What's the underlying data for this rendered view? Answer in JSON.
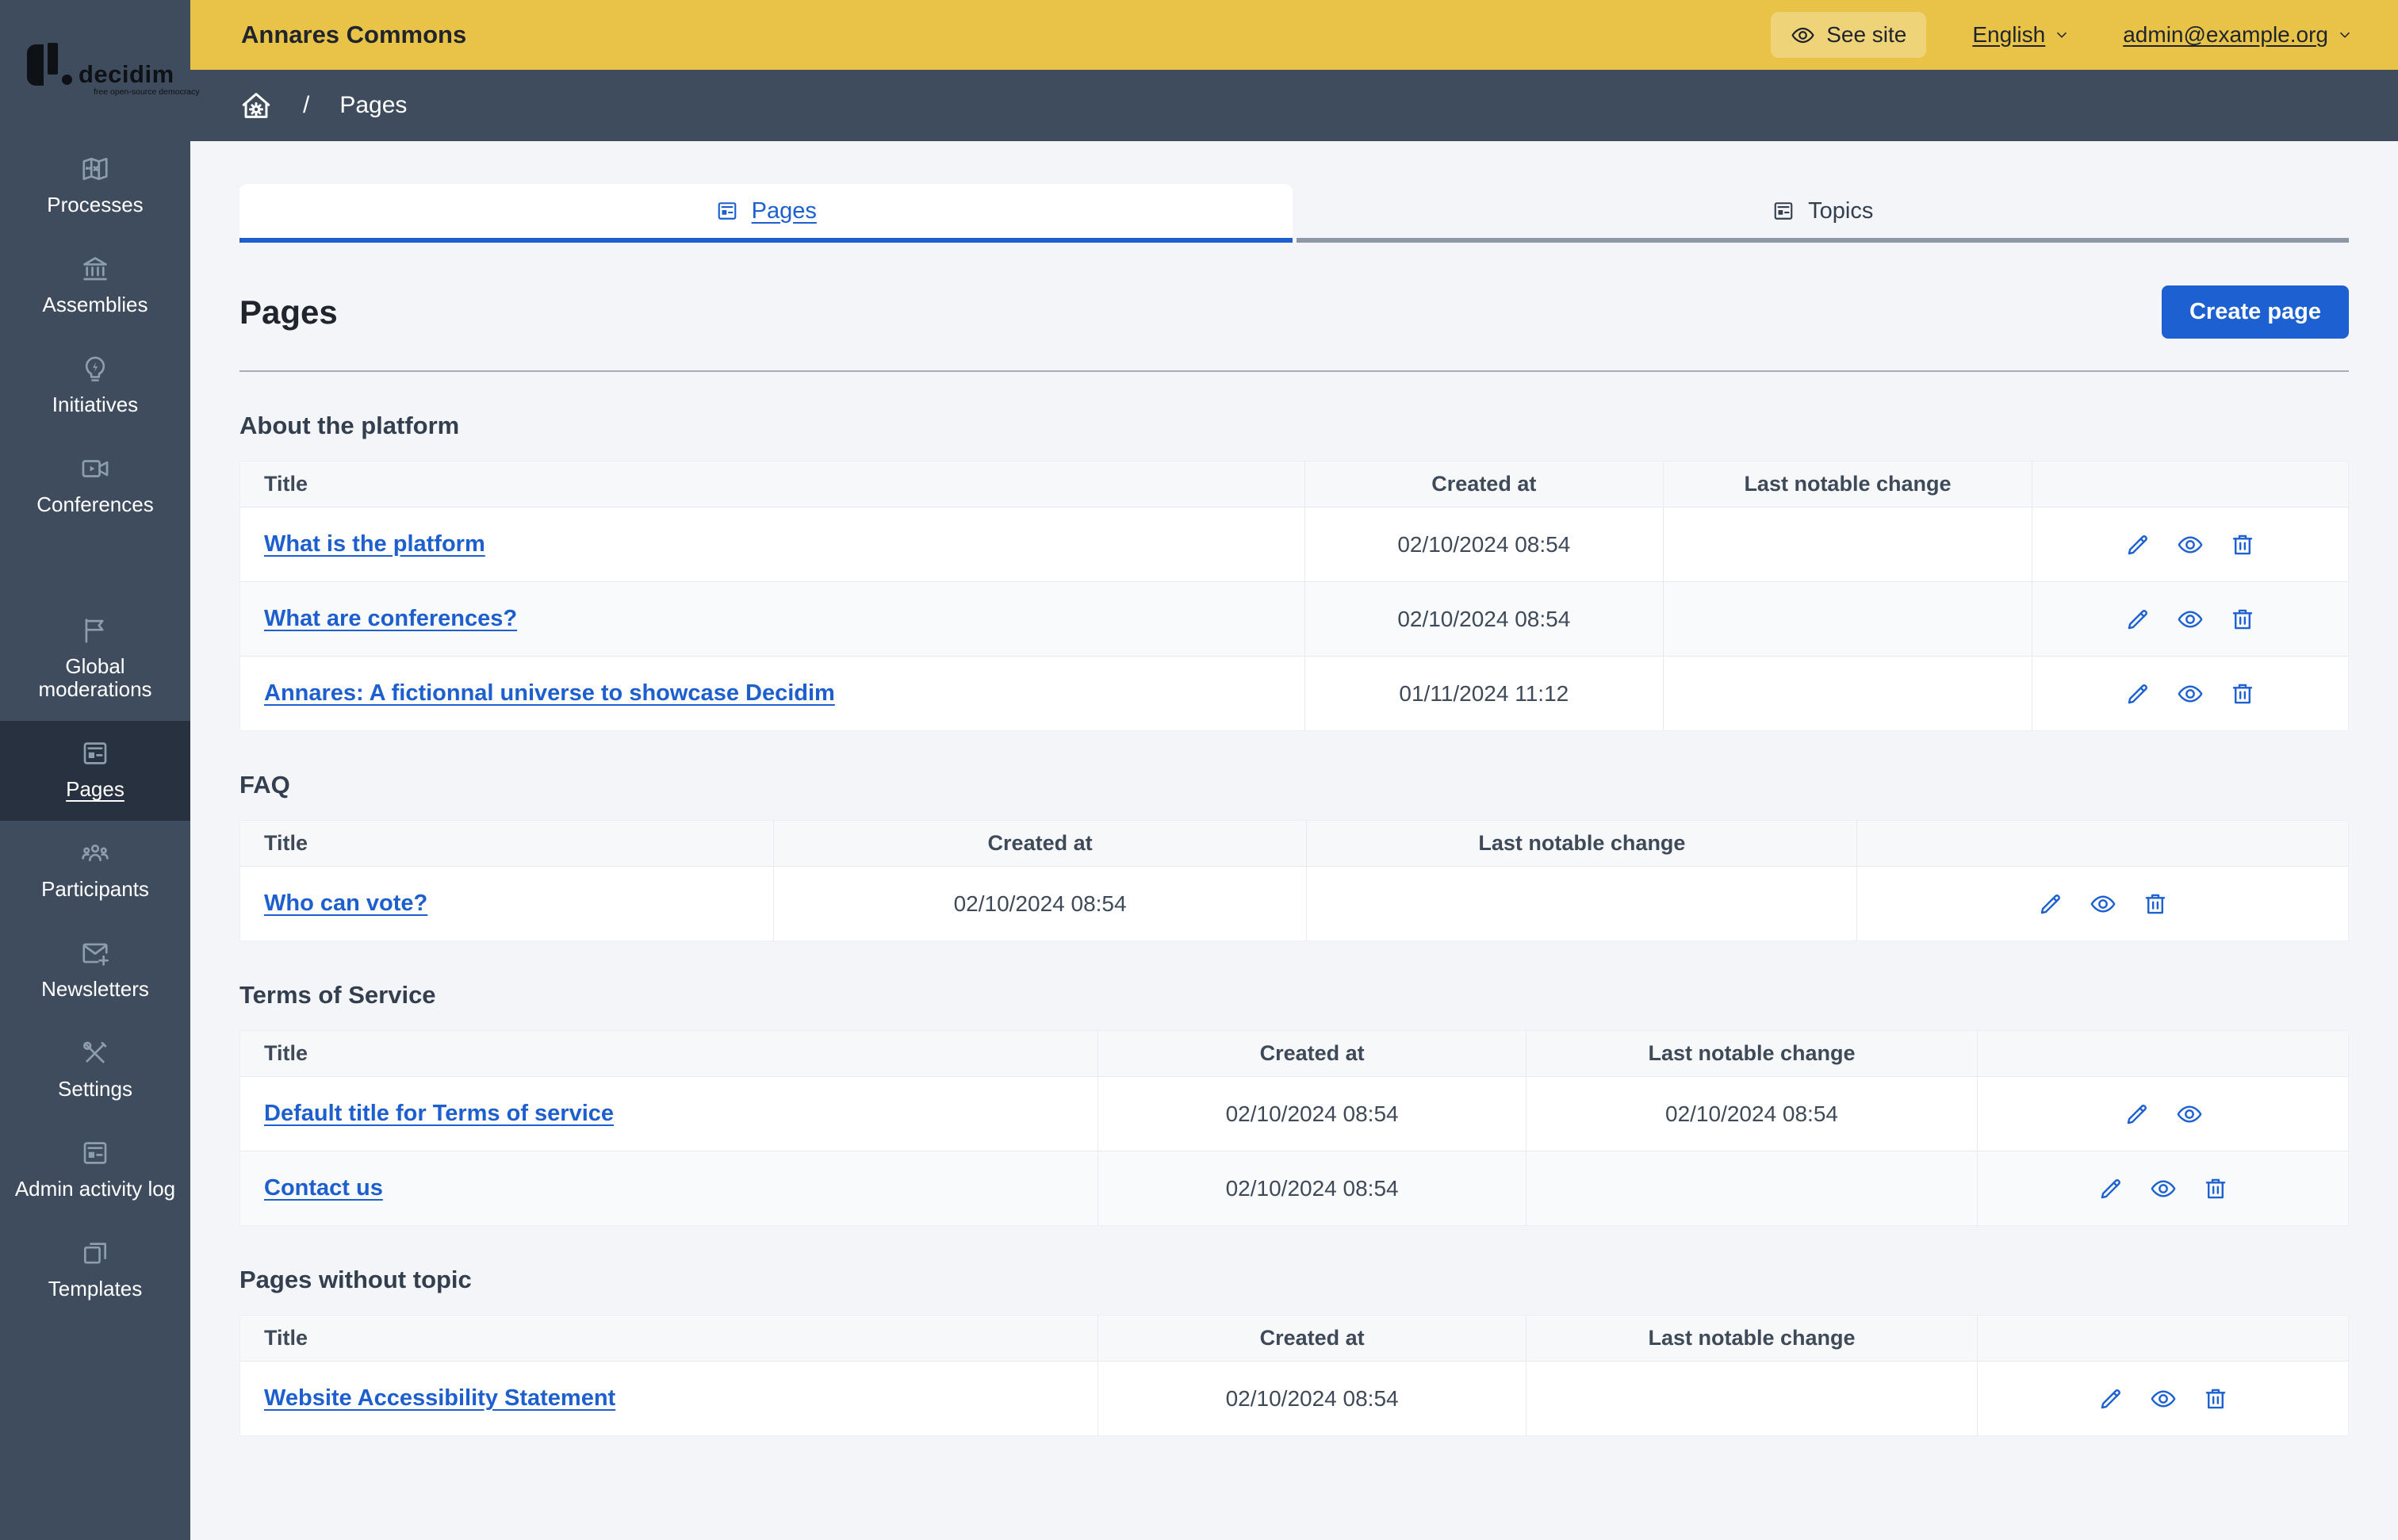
{
  "colors": {
    "accent_blue": "#1d60d1",
    "topbar_yellow": "#e9c347",
    "see_site_pill": "#efd379",
    "sidebar_slate": "#3f4c5e",
    "sidebar_active": "#27313f",
    "page_background": "#f4f5f8"
  },
  "topbar": {
    "title": "Annares Commons",
    "see_site_label": "See site",
    "see_site_icon": "eye-icon",
    "language_label": "English",
    "account_label": "admin@example.org"
  },
  "sidebar": {
    "logo_text": "decidim",
    "logo_tagline": "free open-source democracy",
    "groups": [
      {
        "items": [
          {
            "label": "Processes",
            "icon": "map"
          },
          {
            "label": "Assemblies",
            "icon": "bank"
          },
          {
            "label": "Initiatives",
            "icon": "lightbulb-flash"
          },
          {
            "label": "Conferences",
            "icon": "video-camera"
          }
        ]
      },
      {
        "items": [
          {
            "label": "Global moderations",
            "icon": "flag"
          },
          {
            "label": "Pages",
            "icon": "article",
            "active": true
          },
          {
            "label": "Participants",
            "icon": "team"
          },
          {
            "label": "Newsletters",
            "icon": "mail-add"
          },
          {
            "label": "Settings",
            "icon": "tools"
          },
          {
            "label": "Admin activity log",
            "icon": "article"
          },
          {
            "label": "Templates",
            "icon": "file-copy"
          }
        ]
      }
    ]
  },
  "breadcrumb": {
    "home_icon": "home-gear-icon",
    "separator": "/",
    "current": "Pages"
  },
  "tabs": [
    {
      "label": "Pages",
      "icon": "article",
      "active": true
    },
    {
      "label": "Topics",
      "icon": "article",
      "active": false
    }
  ],
  "page": {
    "title": "Pages",
    "create_button": "Create page"
  },
  "table_columns": [
    "Title",
    "Created at",
    "Last notable change",
    ""
  ],
  "sections": [
    {
      "title": "About the platform",
      "rows": [
        {
          "title": "What is the platform",
          "created_at": "02/10/2024 08:54",
          "last_change": "",
          "actions": [
            "edit",
            "preview",
            "delete"
          ]
        },
        {
          "title": "What are conferences?",
          "created_at": "02/10/2024 08:54",
          "last_change": "",
          "actions": [
            "edit",
            "preview",
            "delete"
          ]
        },
        {
          "title": "Annares: A fictionnal universe to showcase Decidim",
          "created_at": "01/11/2024 11:12",
          "last_change": "",
          "actions": [
            "edit",
            "preview",
            "delete"
          ]
        }
      ]
    },
    {
      "title": "FAQ",
      "rows": [
        {
          "title": "Who can vote?",
          "created_at": "02/10/2024 08:54",
          "last_change": "",
          "actions": [
            "edit",
            "preview",
            "delete"
          ]
        }
      ]
    },
    {
      "title": "Terms of Service",
      "rows": [
        {
          "title": "Default title for Terms of service",
          "created_at": "02/10/2024 08:54",
          "last_change": "02/10/2024 08:54",
          "actions": [
            "edit",
            "preview"
          ]
        },
        {
          "title": "Contact us",
          "created_at": "02/10/2024 08:54",
          "last_change": "",
          "actions": [
            "edit",
            "preview",
            "delete"
          ]
        }
      ]
    },
    {
      "title": "Pages without topic",
      "rows": [
        {
          "title": "Website Accessibility Statement",
          "created_at": "02/10/2024 08:54",
          "last_change": "",
          "actions": [
            "edit",
            "preview",
            "delete"
          ]
        }
      ]
    }
  ]
}
